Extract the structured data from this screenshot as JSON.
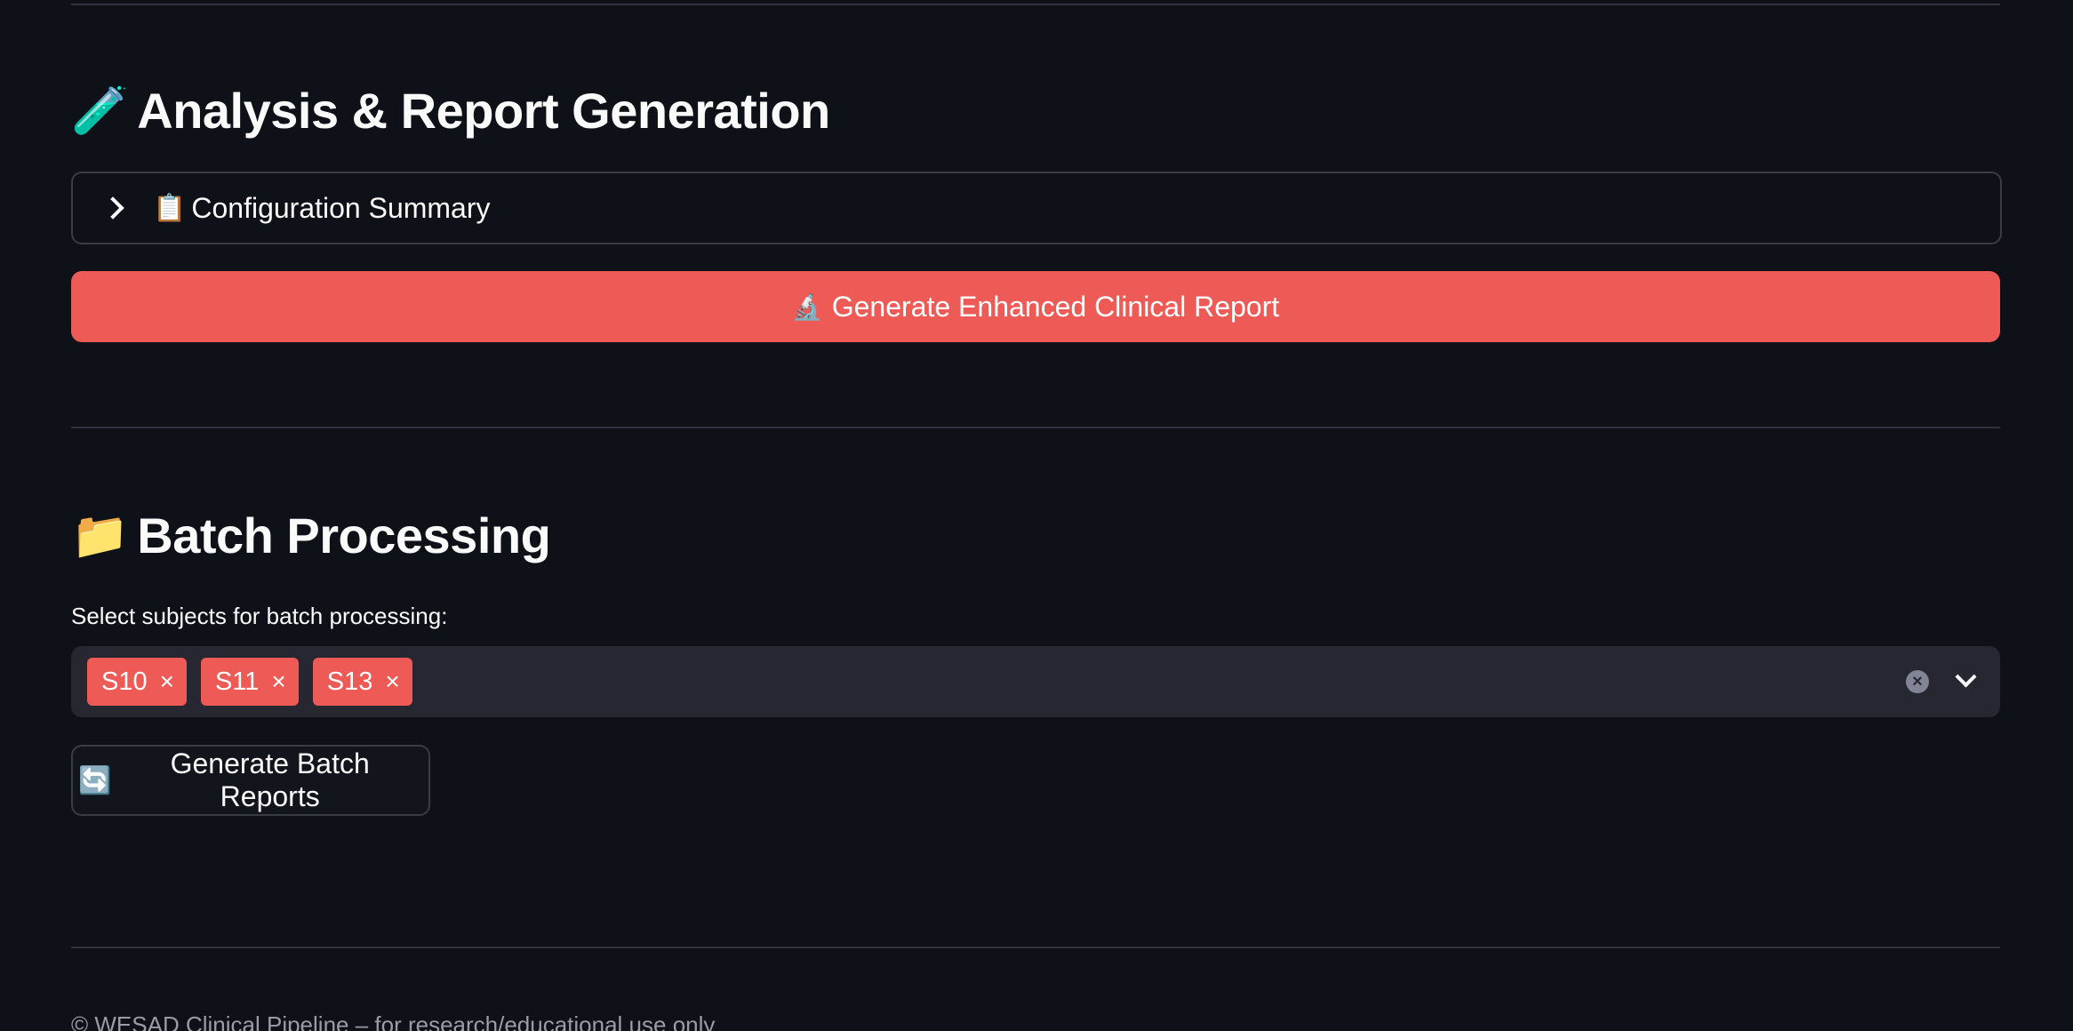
{
  "analysis_section": {
    "icon": "test-tube-icon",
    "emoji": "🧪",
    "title": "Analysis & Report Generation",
    "expander": {
      "emoji": "📋",
      "label": "Configuration Summary",
      "expanded": false
    },
    "primary_button": {
      "emoji": "🔬",
      "label": "Generate Enhanced Clinical Report"
    }
  },
  "batch_section": {
    "icon": "folder-icon",
    "emoji": "📁",
    "title": "Batch Processing",
    "select_label": "Select subjects for batch processing:",
    "selected_subjects": [
      "S10",
      "S11",
      "S13"
    ],
    "tag_remove_glyph": "×",
    "clear_glyph": "×",
    "batch_button": {
      "emoji": "🔄",
      "label": "Generate Batch Reports"
    }
  },
  "footer": {
    "text": "© WESAD Clinical Pipeline – for research/educational use only"
  },
  "colors": {
    "background": "#0e1117",
    "primary": "#ee5a55",
    "input_bg": "#262730",
    "border": "#3a3c46",
    "text": "#fafafa"
  }
}
